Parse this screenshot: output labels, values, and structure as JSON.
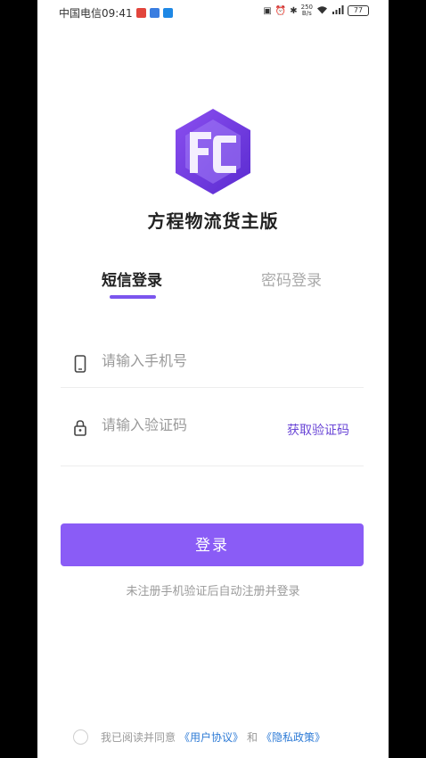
{
  "status_bar": {
    "carrier_time": "中国电信09:41",
    "net_speed_top": "250",
    "net_speed_bottom": "B/s",
    "signal": "⁴ᴳ",
    "battery": "77"
  },
  "app": {
    "logo_text": "FC",
    "title": "方程物流货主版"
  },
  "tabs": [
    {
      "label": "短信登录",
      "active": true
    },
    {
      "label": "密码登录",
      "active": false
    }
  ],
  "form": {
    "phone_placeholder": "请输入手机号",
    "code_placeholder": "请输入验证码",
    "get_code_label": "获取验证码",
    "login_label": "登录",
    "hint": "未注册手机验证后自动注册并登录"
  },
  "agreement": {
    "prefix": "我已阅读并同意",
    "user_agreement": "《用户协议》",
    "and": "和",
    "privacy_policy": "《隐私政策》"
  },
  "colors": {
    "accent": "#8a5cf6",
    "link": "#2e7bd6"
  }
}
